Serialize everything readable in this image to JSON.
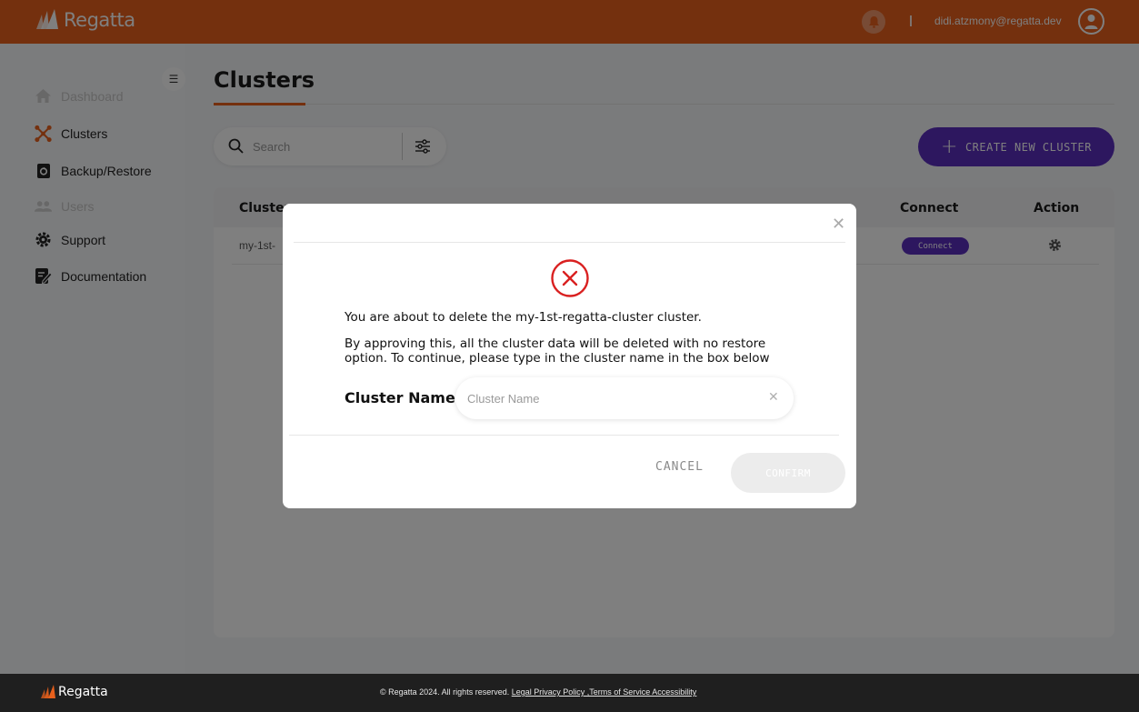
{
  "header": {
    "app_name": "Regatta",
    "user_email": "didi.atzmony@regatta.dev",
    "brand_color": "#e8601c"
  },
  "sidebar": {
    "items": [
      {
        "label": "Dashboard",
        "icon": "home-icon",
        "enabled": false
      },
      {
        "label": "Clusters",
        "icon": "clusters-icon",
        "enabled": true
      },
      {
        "label": "Backup/Restore",
        "icon": "backup-icon",
        "enabled": true
      },
      {
        "label": "Users",
        "icon": "users-icon",
        "enabled": false
      },
      {
        "label": "Support",
        "icon": "support-icon",
        "enabled": true
      },
      {
        "label": "Documentation",
        "icon": "documentation-icon",
        "enabled": true
      }
    ]
  },
  "main": {
    "title": "Clusters",
    "search_placeholder": "Search",
    "create_button_label": "CREATE NEW CLUSTER",
    "accent_color": "#5b2fbf"
  },
  "table": {
    "columns": [
      "Cluster",
      "Connect",
      "Action"
    ],
    "rows": [
      {
        "name": "my-1st-",
        "connect_label": "Connect",
        "action_icon": "gear-icon"
      }
    ]
  },
  "modal": {
    "message_line1": "You are about to delete the my-1st-regatta-cluster cluster.",
    "message_line2": "By approving this, all the cluster data will be deleted with no restore option. To continue, please type in the cluster name in the box below",
    "field_label": "Cluster Name:",
    "field_placeholder": "Cluster Name",
    "field_value": "",
    "cancel_label": "CANCEL",
    "confirm_label": "CONFIRM",
    "error_color": "#d92020"
  },
  "footer": {
    "logo_text": "Regatta",
    "copyright": "© Regatta 2024. All rights reserved.",
    "links": [
      "Legal Privacy Policy ,Terms of Service Accessibility"
    ]
  }
}
